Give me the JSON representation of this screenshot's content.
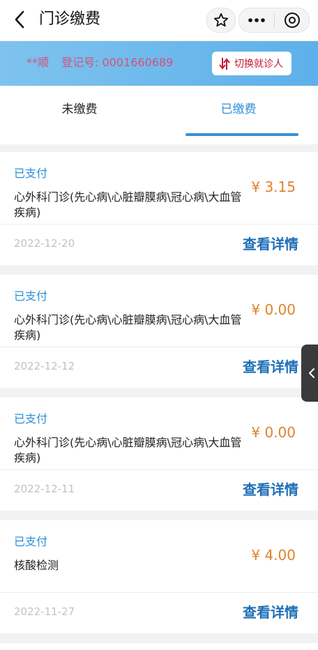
{
  "header": {
    "title": "门诊缴费",
    "icons": {
      "back": "chevron-left-icon",
      "favorite": "star-icon",
      "more": "more-icon",
      "close": "close-circle-icon"
    }
  },
  "patient": {
    "name": "**顺",
    "registration_label": "登记号:",
    "registration_no": "0001660689",
    "switch_button": "切换就诊人",
    "switch_icon": "swap-arrows-icon"
  },
  "tabs": [
    {
      "label": "未缴费",
      "active": false
    },
    {
      "label": "已缴费",
      "active": true
    }
  ],
  "records": [
    {
      "status": "已支付",
      "item": "心外科门诊(先心病\\心脏瓣膜病\\冠心病\\大血管疾病)",
      "amount": "¥ 3.15",
      "date": "2022-12-20",
      "action": "查看详情"
    },
    {
      "status": "已支付",
      "item": "心外科门诊(先心病\\心脏瓣膜病\\冠心病\\大血管疾病)",
      "amount": "¥ 0.00",
      "date": "2022-12-12",
      "action": "查看详情"
    },
    {
      "status": "已支付",
      "item": "心外科门诊(先心病\\心脏瓣膜病\\冠心病\\大血管疾病)",
      "amount": "¥ 0.00",
      "date": "2022-12-11",
      "action": "查看详情"
    },
    {
      "status": "已支付",
      "item": "核酸检测",
      "amount": "¥ 4.00",
      "date": "2022-11-27",
      "action": "查看详情"
    }
  ],
  "colors": {
    "accent": "#2f8fd8",
    "amount": "#e0832b",
    "banner": "#5eb0ea",
    "patient_text": "#d6507a",
    "switch_text": "#c0192f"
  }
}
